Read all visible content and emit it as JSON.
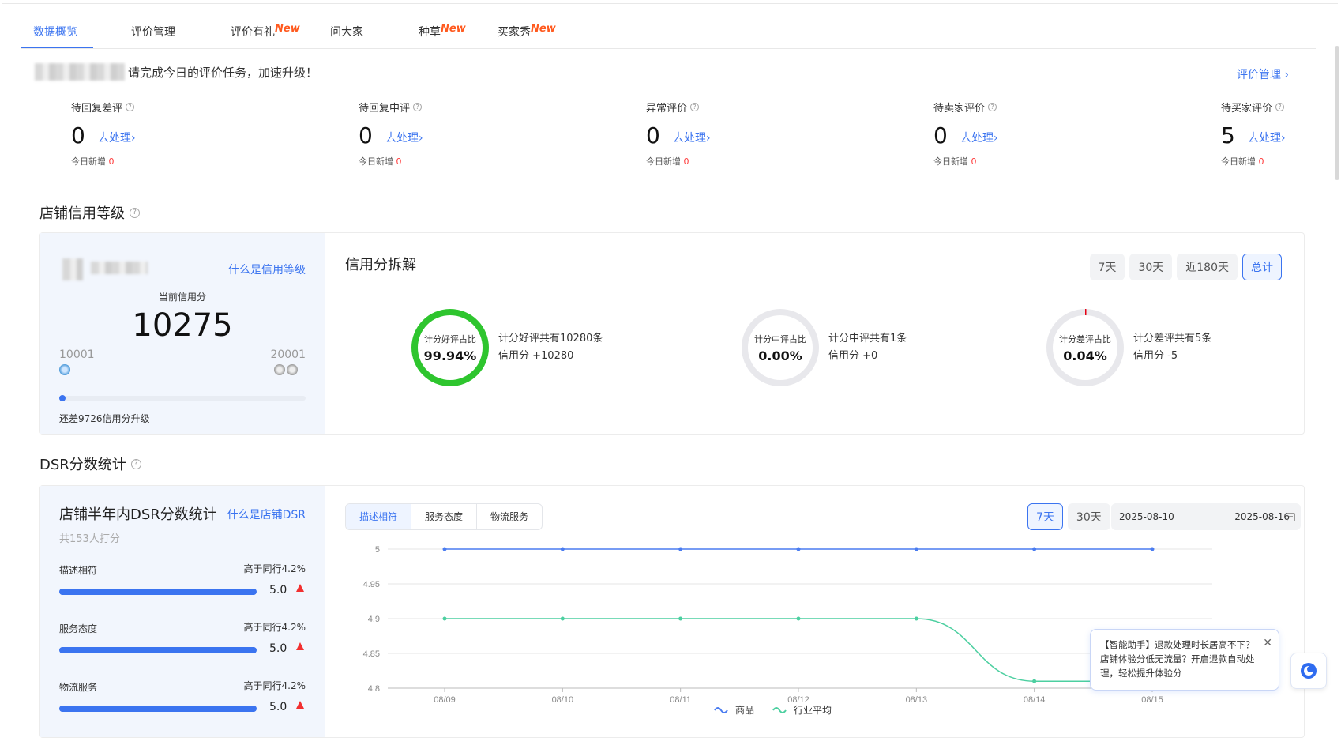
{
  "tabs": [
    {
      "label": "数据概览",
      "is_new": false,
      "active": true
    },
    {
      "label": "评价管理",
      "is_new": false,
      "active": false
    },
    {
      "label": "评价有礼",
      "is_new": true,
      "active": false
    },
    {
      "label": "问大家",
      "is_new": false,
      "active": false
    },
    {
      "label": "种草",
      "is_new": true,
      "active": false
    },
    {
      "label": "买家秀",
      "is_new": true,
      "active": false
    }
  ],
  "new_tag": "New",
  "notice": {
    "text": "请完成今日的评价任务，加速升级！",
    "mgmt_link": "评价管理 ›"
  },
  "todos": [
    {
      "label": "待回复差评",
      "value": "0",
      "action": "去处理›",
      "today_label": "今日新增",
      "today_value": "0"
    },
    {
      "label": "待回复中评",
      "value": "0",
      "action": "去处理›",
      "today_label": "今日新增",
      "today_value": "0"
    },
    {
      "label": "异常评价",
      "value": "0",
      "action": "去处理›",
      "today_label": "今日新增",
      "today_value": "0"
    },
    {
      "label": "待卖家评价",
      "value": "0",
      "action": "去处理›",
      "today_label": "今日新增",
      "today_value": "0"
    },
    {
      "label": "待买家评价",
      "value": "5",
      "action": "去处理›",
      "today_label": "今日新增",
      "today_value": "0"
    }
  ],
  "credit": {
    "section_title": "店铺信用等级",
    "what_link": "什么是信用等级",
    "current_label": "当前信用分",
    "score": "10275",
    "min": "10001",
    "max": "20001",
    "remaining": "还差9726信用分升级",
    "breakdown_title": "信用分拆解",
    "ranges": [
      "7天",
      "30天",
      "近180天",
      "总计"
    ],
    "active_range": 3,
    "rings": [
      {
        "label": "计分好评占比",
        "percent": "99.94%",
        "fraction": 0.9994,
        "color": "#2ec52e",
        "line1": "计分好评共有10280条",
        "line2": "信用分 +10280"
      },
      {
        "label": "计分中评占比",
        "percent": "0.00%",
        "fraction": 0.0,
        "color": "#e8e8ec",
        "line1": "计分中评共有1条",
        "line2": "信用分 +0"
      },
      {
        "label": "计分差评占比",
        "percent": "0.04%",
        "fraction": 0.0004,
        "color": "#e60012",
        "line1": "计分差评共有5条",
        "line2": "信用分 -5"
      }
    ]
  },
  "dsr": {
    "section_title": "DSR分数统计",
    "card_title": "店铺半年内DSR分数统计",
    "what_link": "什么是店铺DSR",
    "count": "共153人打分",
    "rows": [
      {
        "label": "描述相符",
        "compare": "高于同行4.2%",
        "value": "5.0"
      },
      {
        "label": "服务态度",
        "compare": "高于同行4.2%",
        "value": "5.0"
      },
      {
        "label": "物流服务",
        "compare": "高于同行4.2%",
        "value": "5.0"
      }
    ],
    "tabs": [
      "描述相符",
      "服务态度",
      "物流服务"
    ],
    "ranges": [
      "7天",
      "30天"
    ],
    "date_start": "2025-08-10",
    "date_end": "2025-08-16"
  },
  "chart_data": {
    "type": "line",
    "x": [
      "08/09",
      "08/10",
      "08/11",
      "08/12",
      "08/13",
      "08/14",
      "08/15"
    ],
    "y_ticks": [
      "5",
      "4.95",
      "4.9",
      "4.85",
      "4.8"
    ],
    "ylim": [
      4.8,
      5.0
    ],
    "grid": true,
    "legend_position": "bottom",
    "series": [
      {
        "name": "商品",
        "color": "#4a7cf0",
        "values": [
          5.0,
          5.0,
          5.0,
          5.0,
          5.0,
          5.0,
          5.0
        ]
      },
      {
        "name": "行业平均",
        "color": "#4ccfa0",
        "values": [
          4.9,
          4.9,
          4.9,
          4.9,
          4.9,
          4.81,
          4.81
        ]
      }
    ]
  },
  "tooltip": {
    "text": "【智能助手】退款处理时长居高不下？店铺体验分低无流量？开启退款自动处理，轻松提升体验分"
  }
}
